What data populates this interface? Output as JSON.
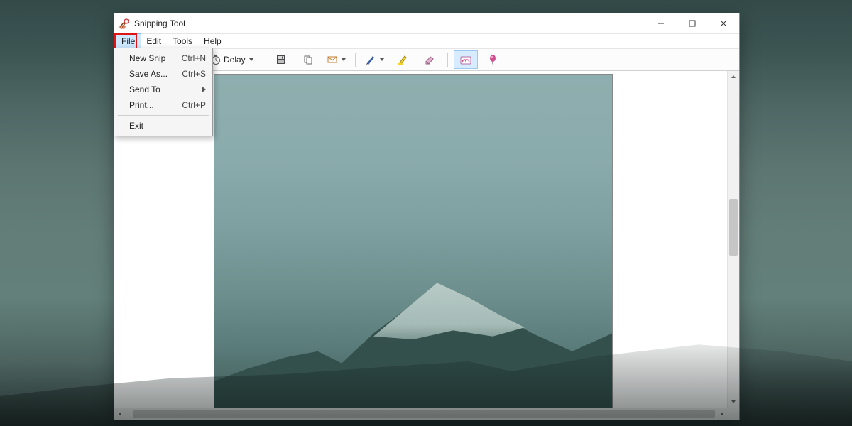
{
  "window": {
    "title": "Snipping Tool"
  },
  "menubar": {
    "items": [
      "File",
      "Edit",
      "Tools",
      "Help"
    ],
    "active_index": 0
  },
  "file_menu": {
    "items": [
      {
        "label": "New Snip",
        "shortcut": "Ctrl+N",
        "submenu": false
      },
      {
        "label": "Save As...",
        "shortcut": "Ctrl+S",
        "submenu": false,
        "highlighted": true
      },
      {
        "label": "Send To",
        "shortcut": "",
        "submenu": true
      },
      {
        "label": "Print...",
        "shortcut": "Ctrl+P",
        "submenu": false
      },
      {
        "separator": true
      },
      {
        "label": "Exit",
        "shortcut": "",
        "submenu": false
      }
    ]
  },
  "toolbar": {
    "delay_label": "Delay"
  }
}
